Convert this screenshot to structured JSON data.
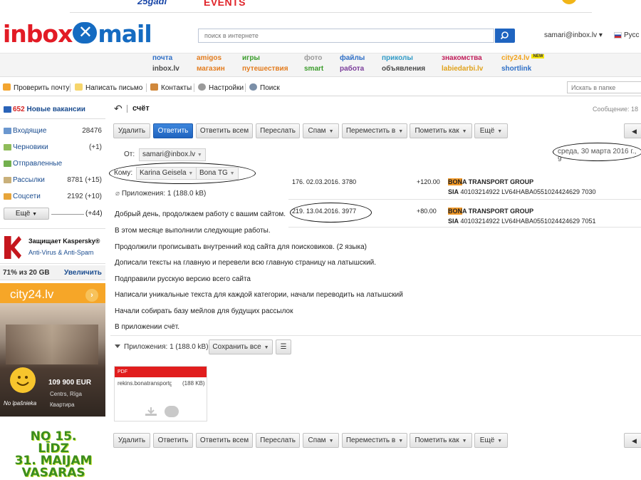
{
  "banner": {
    "left_text": "25gadi",
    "events": "EVENTS"
  },
  "header": {
    "logo_a": "inbox",
    "logo_x": "✕",
    "logo_b": "mail",
    "search_placeholder": "поиск в интернете",
    "user_email": "samari@inbox.lv",
    "language": "Русс"
  },
  "services": {
    "row1": [
      {
        "label": "почта",
        "color": "#2f6fc6"
      },
      {
        "label": "amigos",
        "color": "#e37c1e"
      },
      {
        "label": "игры",
        "color": "#3a9c2b"
      },
      {
        "label": "фото",
        "color": "#9b9b9b"
      },
      {
        "label": "файлы",
        "color": "#2f6fc6"
      },
      {
        "label": "приколы",
        "color": "#2f9ac6"
      },
      {
        "label": "знакомства",
        "color": "#c01e5a"
      },
      {
        "label": "city24.lv",
        "color": "#f0a21b",
        "badge": "NEW"
      }
    ],
    "row2": [
      {
        "label": "inbox.lv",
        "color": "#4a4a4a"
      },
      {
        "label": "магазин",
        "color": "#e37c1e"
      },
      {
        "label": "путешествия",
        "color": "#e37c1e"
      },
      {
        "label": "smart",
        "color": "#3a9c2b"
      },
      {
        "label": "работа",
        "color": "#7a3c9a"
      },
      {
        "label": "объявления",
        "color": "#4a4a4a"
      },
      {
        "label": "labiedarbi.lv",
        "color": "#e0a21b"
      },
      {
        "label": "shortlink",
        "color": "#2f6fc6"
      }
    ]
  },
  "toolbar": {
    "check_mail": "Проверить почту",
    "compose": "Написать письмо",
    "contacts": "Контакты",
    "settings": "Настройки",
    "search": "Поиск",
    "folder_search_placeholder": "Искать в папке"
  },
  "sidebar": {
    "jobs_count": "652",
    "jobs_label": "Новые вакансии",
    "folders": [
      {
        "label": "Входящие",
        "count": "28476"
      },
      {
        "label": "Черновики",
        "count": "(+1)"
      },
      {
        "label": "Отправленные",
        "count": ""
      },
      {
        "label": "Рассылки",
        "count": "8781 (+15)"
      },
      {
        "label": "Соцсети",
        "count": "2192 (+10)"
      }
    ],
    "more_label": "Ещё",
    "more_count": "(+44)"
  },
  "ads": {
    "kaspersky_title": "Защищает Kaspersky®",
    "kaspersky_sub": "Anti-Virus & Anti-Spam",
    "quota": "71% из 20 GB",
    "upgrade": "Увеличить",
    "city24_logo": "city24.lv",
    "city24_price": "109 900 EUR",
    "city24_city": "Centrs, Rīga",
    "city24_type": "Квартира",
    "city24_owner": "No īpašnieka",
    "bottom_ad": [
      "NO 15. LĪDZ",
      "31. MAIJAM",
      "VASARAS"
    ]
  },
  "message": {
    "subject": "счёт",
    "counter": "Сообщение: 18",
    "buttons": {
      "delete": "Удалить",
      "reply": "Ответить",
      "reply_all": "Ответить всем",
      "forward": "Переслать",
      "spam": "Спам",
      "move": "Переместить в",
      "mark": "Пометить как",
      "more": "Ещё"
    },
    "from_label": "От:",
    "from": "samari@inbox.lv",
    "date": "среда, 30 марта 2016 г., 9",
    "to_label": "Кому:",
    "to": [
      "Karina Geisela",
      "Bona TG"
    ],
    "attachments_head": "Приложения: 1 (188.0 kB)",
    "body": [
      "Добрый день, продолжаем работу с вашим сайтом.",
      "В этом месяце выполнили следующие работы.",
      "Продолжили прописывать внутренний код сайта для поисковиков. (2 языка)",
      "Дописали тексты на главную и перевели всю главную страницу на латышский.",
      "Подправили русскую версию всего сайта",
      "Написали уникальные текста для каждой категории, начали переводить на латышский",
      "Начали собирать базу мейлов для будущих рассылок",
      "В приложении счёт."
    ],
    "invoice": [
      {
        "num": "176. 02.03.2016. 3780",
        "amount": "+120.00",
        "company_hl": "BON",
        "company": "A TRANSPORT GROUP",
        "acc_prefix": "SIA",
        "acc": "40103214922 LV64HABA0551024424629 7030"
      },
      {
        "num": "219. 13.04.2016. 3977",
        "amount": "+80.00",
        "company_hl": "BON",
        "company": "A TRANSPORT GROUP",
        "acc_prefix": "SIA",
        "acc": "40103214922 LV64HABA0551024424629 7051"
      }
    ],
    "attachments_bar": "Приложения: 1 (188.0 kB)",
    "save_all": "Сохранить все",
    "file": {
      "type": "PDF",
      "name": "rekins.bonatransportgroup",
      "size": "(188 KB)"
    }
  }
}
